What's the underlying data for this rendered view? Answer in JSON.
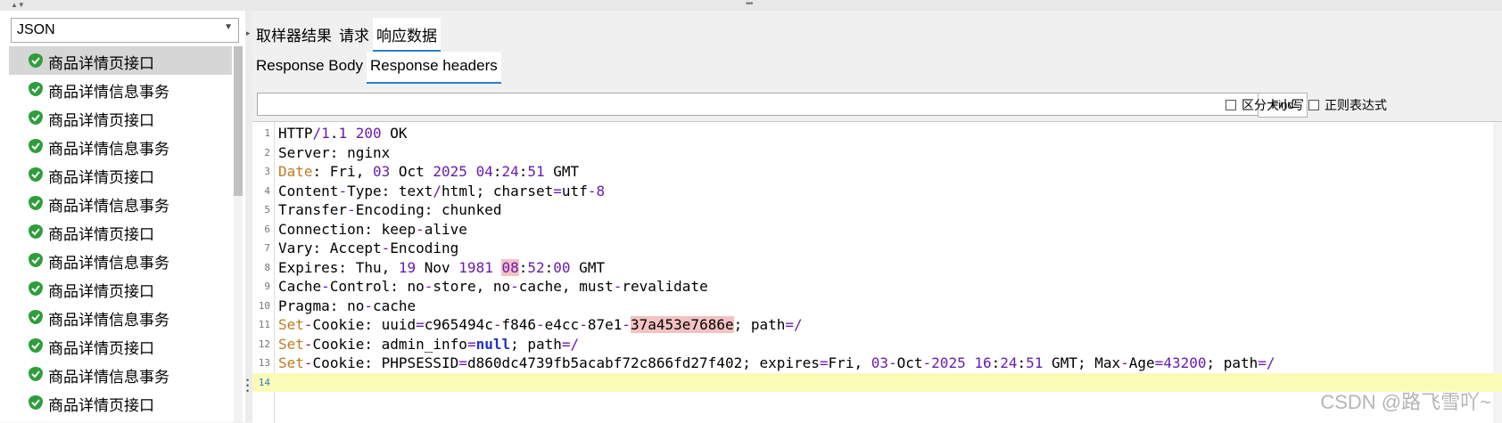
{
  "left_panel": {
    "renderer": "JSON",
    "items": [
      {
        "label": "商品详情页接口",
        "selected": true
      },
      {
        "label": "商品详情信息事务",
        "selected": false
      },
      {
        "label": "商品详情页接口",
        "selected": false
      },
      {
        "label": "商品详情信息事务",
        "selected": false
      },
      {
        "label": "商品详情页接口",
        "selected": false
      },
      {
        "label": "商品详情信息事务",
        "selected": false
      },
      {
        "label": "商品详情页接口",
        "selected": false
      },
      {
        "label": "商品详情信息事务",
        "selected": false
      },
      {
        "label": "商品详情页接口",
        "selected": false
      },
      {
        "label": "商品详情信息事务",
        "selected": false
      },
      {
        "label": "商品详情页接口",
        "selected": false
      },
      {
        "label": "商品详情信息事务",
        "selected": false
      },
      {
        "label": "商品详情页接口",
        "selected": false
      }
    ]
  },
  "main_tabs": [
    {
      "label": "取样器结果",
      "active": false
    },
    {
      "label": "请求",
      "active": false
    },
    {
      "label": "响应数据",
      "active": true
    }
  ],
  "sub_tabs": [
    {
      "label": "Response Body",
      "active": false
    },
    {
      "label": "Response headers",
      "active": true
    }
  ],
  "find": {
    "value": "",
    "button": "Find",
    "case_label": "区分大小写",
    "regex_label": "正则表达式"
  },
  "editor": {
    "current_line": 14,
    "lines": [
      "HTTP/1.1 200 OK",
      "Server: nginx",
      "Date: Fri, 03 Oct 2025 04:24:51 GMT",
      "Content-Type: text/html; charset=utf-8",
      "Transfer-Encoding: chunked",
      "Connection: keep-alive",
      "Vary: Accept-Encoding",
      "Expires: Thu, 19 Nov 1981 08:52:00 GMT",
      "Cache-Control: no-store, no-cache, must-revalidate",
      "Pragma: no-cache",
      "Set-Cookie: uuid=c965494c-f846-e4cc-87e1-37a453e7686e; path=/",
      "Set-Cookie: admin_info=null; path=/",
      "Set-Cookie: PHPSESSID=d860dc4739fb5acabf72c866fd27f402; expires=Fri, 03-Oct-2025 16:24:51 GMT; Max-Age=43200; path=/",
      ""
    ]
  },
  "watermark": "CSDN @路飞雪吖~",
  "colors": {
    "accent": "#2f7dc9",
    "success_icon": "#2e9e3a",
    "current_line_bg": "#fbfbb8",
    "number": "#6a1bb0",
    "keyword_highlight": "#c27a1d"
  }
}
